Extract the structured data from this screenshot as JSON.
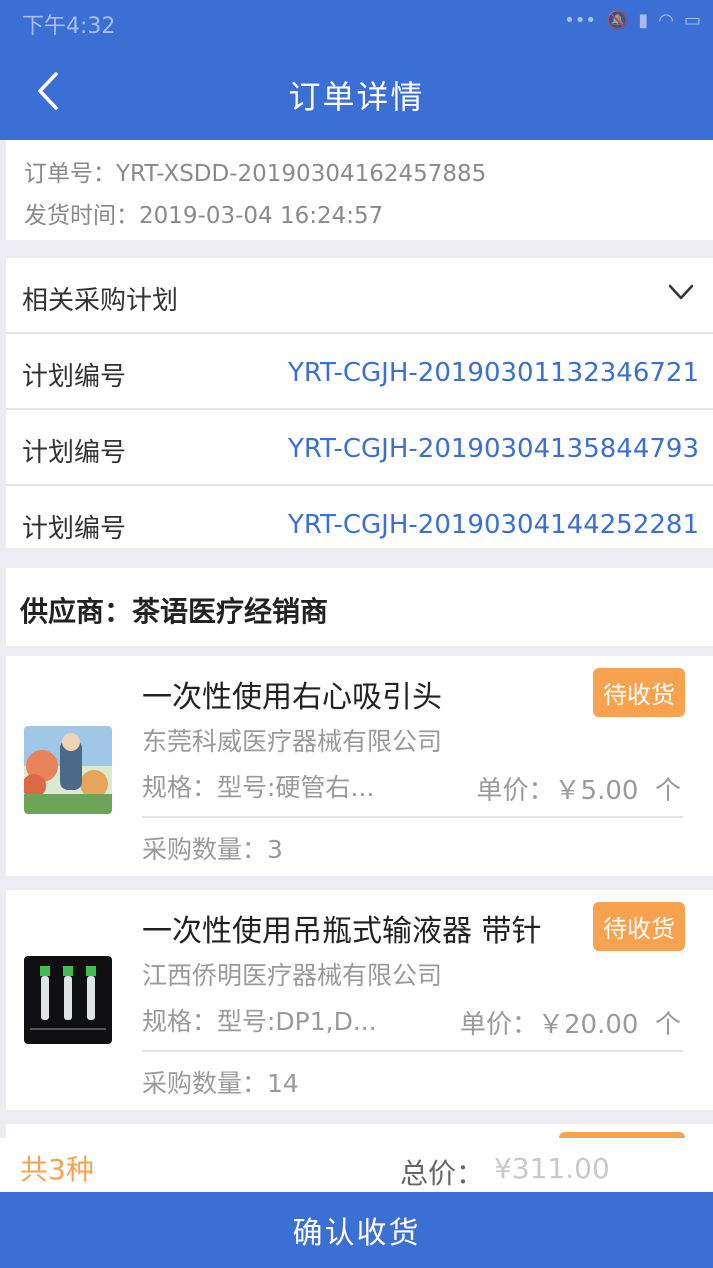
{
  "status_bar": {
    "time": "下午4:32",
    "icons": [
      "signal-dots-icon",
      "mute-icon",
      "cell-signal-icon",
      "wifi-icon",
      "battery-icon"
    ]
  },
  "header": {
    "title": "订单详情",
    "back_icon": "chevron-left-icon"
  },
  "order": {
    "number_label": "订单号",
    "number_value": "YRT-XSDD-20190304162457885",
    "ship_time_label": "发货时间",
    "ship_time_value": "2019-03-04 16:24:57"
  },
  "plans": {
    "section_title": "相关采购计划",
    "toggle_icon": "chevron-down-icon",
    "rows": [
      {
        "label": "计划编号",
        "value": "YRT-CGJH-20190301132346721"
      },
      {
        "label": "计划编号",
        "value": "YRT-CGJH-20190304135844793"
      },
      {
        "label": "计划编号",
        "value": "YRT-CGJH-20190304144252281"
      }
    ]
  },
  "supplier": {
    "label": "供应商：茶语医疗经销商"
  },
  "items": [
    {
      "name": "一次性使用右心吸引头",
      "status": "待收货",
      "company": "东莞科威医疗器械有限公司",
      "spec": "规格：型号:硬管右...",
      "price": "单价：￥5.00",
      "unit": "个",
      "quantity": "采购数量：3"
    },
    {
      "name": "一次性使用吊瓶式输液器 带针",
      "status": "待收货",
      "company": "江西侨明医疗器械有限公司",
      "spec": "规格：型号:DP1,D...",
      "price": "单价：￥20.00",
      "unit": "个",
      "quantity": "采购数量：14"
    }
  ],
  "summary": {
    "count": "共3种",
    "total_label": "总价：",
    "total_value": "¥311.00"
  },
  "footer": {
    "confirm_label": "确认收货"
  },
  "colors": {
    "primary": "#3b6fd4",
    "badge": "#f7a24e",
    "link": "#3b6fd4"
  }
}
